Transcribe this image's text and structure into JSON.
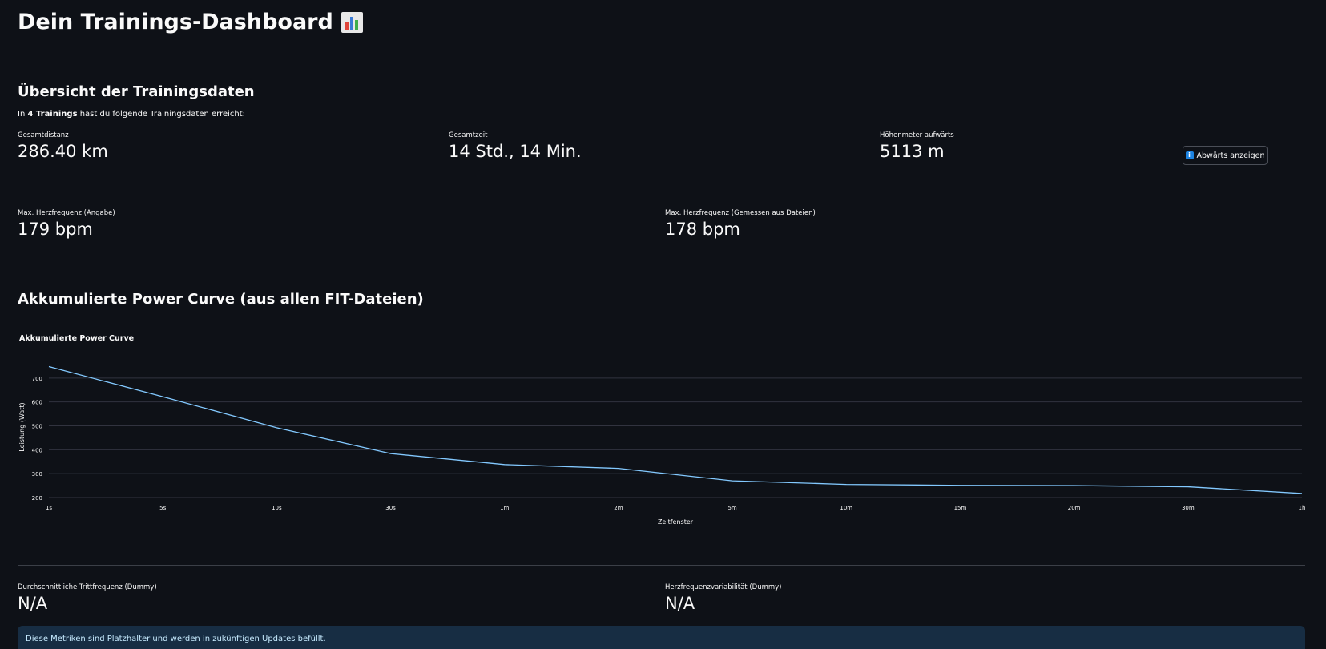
{
  "header": {
    "title": "Dein Trainings-Dashboard",
    "icon": "bar-chart-icon"
  },
  "overview": {
    "heading": "Übersicht der Trainingsdaten",
    "intro_prefix": "In ",
    "intro_bold": "4 Trainings",
    "intro_suffix": " hast du folgende Trainingsdaten erreicht:",
    "metrics": [
      {
        "label": "Gesamtdistanz",
        "value": "286.40 km"
      },
      {
        "label": "Gesamtzeit",
        "value": "14 Std., 14 Min."
      },
      {
        "label": "Höhenmeter aufwärts",
        "value": "5113 m"
      }
    ],
    "toggle_button": "Abwärts anzeigen"
  },
  "heart_rate": {
    "metrics": [
      {
        "label": "Max. Herzfrequenz (Angabe)",
        "value": "179 bpm"
      },
      {
        "label": "Max. Herzfrequenz (Gemessen aus Dateien)",
        "value": "178 bpm"
      }
    ]
  },
  "power_curve": {
    "heading": "Akkumulierte Power Curve (aus allen FIT-Dateien)"
  },
  "chart_data": {
    "type": "line",
    "title": "Akkumulierte Power Curve",
    "xlabel": "Zeitfenster",
    "ylabel": "Leistung (Watt)",
    "categories": [
      "1s",
      "5s",
      "10s",
      "30s",
      "1m",
      "2m",
      "5m",
      "10m",
      "15m",
      "20m",
      "30m",
      "1h"
    ],
    "series": [
      {
        "values": [
          748,
          622,
          492,
          384,
          338,
          322,
          270,
          255,
          251,
          250,
          245,
          217
        ]
      }
    ],
    "yticks": [
      200,
      300,
      400,
      500,
      600,
      700
    ],
    "ylim": [
      200,
      790
    ],
    "grid": true,
    "line_color": "#83c9ff"
  },
  "extra_metrics": {
    "metrics": [
      {
        "label": "Durchschnittliche Trittfrequenz (Dummy)",
        "value": "N/A"
      },
      {
        "label": "Herzfrequenzvariabilität (Dummy)",
        "value": "N/A"
      }
    ],
    "note": "Diese Metriken sind Platzhalter und werden in zukünftigen Updates befüllt."
  }
}
